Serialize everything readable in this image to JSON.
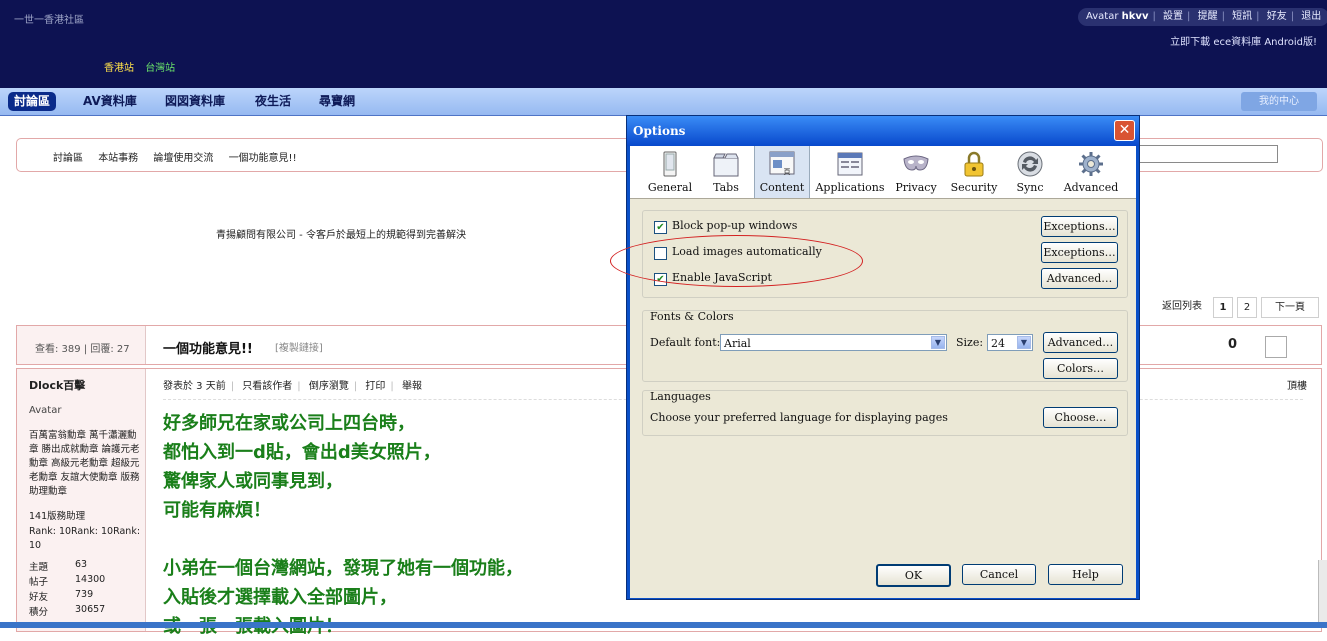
{
  "forum": {
    "site_name": "一世一香港社區",
    "stations": [
      "香港站",
      "台灣站"
    ],
    "userbar": {
      "avatar_label": "Avatar",
      "username": "hkvv",
      "links": [
        "設置",
        "提醒",
        "短訊",
        "好友",
        "退出"
      ]
    },
    "download_note": "立即下載 ece資料庫 Android版!",
    "nav": {
      "tabs": [
        "討論區",
        "AV資料庫",
        "図図資料庫",
        "夜生活",
        "尋寶網"
      ],
      "my_center": "我的中心"
    },
    "breadcrumb": [
      "討論區",
      "本站事務",
      "論壇使用交流",
      "一個功能意見!!"
    ],
    "ad_text": "青揚顧問有限公司 - 令客戶於最短上的規範得到完善解決",
    "pager": {
      "back_label": "返回列表",
      "pages": [
        "1",
        "2"
      ],
      "next_label": "下一頁"
    },
    "thread": {
      "stats": "查看: 389 | 回覆: 27",
      "title": "一個功能意見!!",
      "copy_link": "[複製鏈接]",
      "reply_count": "0"
    },
    "post": {
      "author": "Dlock百擊",
      "avatar": "Avatar",
      "badges": "百萬富翁勳章 萬千瀟灑勳章 勝出成就勳章 論護元老勳章 高級元老勳章 超級元老勳章 友誼大使勳章 版務助理勳章",
      "points": "141版務助理",
      "rank": "Rank: 10Rank: 10Rank: 10",
      "stats": [
        {
          "label": "主題",
          "value": "63"
        },
        {
          "label": "帖子",
          "value": "14300"
        },
        {
          "label": "好友",
          "value": "739"
        },
        {
          "label": "積分",
          "value": "30657"
        }
      ],
      "toolbar": [
        "發表於 3 天前",
        "只看該作者",
        "倒序瀏覽",
        "打印",
        "舉報"
      ],
      "top_link": "頂樓",
      "body_lines": [
        "好多師兄在家或公司上四台時，",
        "都怕入到一d貼，會出d美女照片，",
        "驚俾家人或同事見到，",
        "可能有麻煩！",
        "",
        "小弟在一個台灣網站，發現了她有一個功能，",
        "入貼後才選擇載入全部圖片，",
        "或一張一張載入圖片！"
      ]
    }
  },
  "dialog": {
    "title": "Options",
    "close_glyph": "✕",
    "panes": [
      {
        "label": "General",
        "icon": "general-icon"
      },
      {
        "label": "Tabs",
        "icon": "tabs-icon"
      },
      {
        "label": "Content",
        "icon": "content-icon",
        "selected": true
      },
      {
        "label": "Applications",
        "icon": "applications-icon"
      },
      {
        "label": "Privacy",
        "icon": "privacy-icon"
      },
      {
        "label": "Security",
        "icon": "security-icon"
      },
      {
        "label": "Sync",
        "icon": "sync-icon"
      },
      {
        "label": "Advanced",
        "icon": "advanced-icon"
      }
    ],
    "content_group": {
      "block_popups": {
        "label": "Block pop-up windows",
        "checked": true,
        "button": "Exceptions…"
      },
      "load_images": {
        "label": "Load images automatically",
        "checked": false,
        "button": "Exceptions…"
      },
      "enable_js": {
        "label": "Enable JavaScript",
        "checked": true,
        "button": "Advanced…"
      }
    },
    "fonts_group": {
      "title": "Fonts & Colors",
      "default_font_label": "Default font:",
      "default_font_value": "Arial",
      "size_label": "Size:",
      "size_value": "24",
      "advanced_button": "Advanced…",
      "colors_button": "Colors…"
    },
    "languages_group": {
      "title": "Languages",
      "description": "Choose your preferred language for displaying pages",
      "choose_button": "Choose…"
    },
    "footer": {
      "ok": "OK",
      "cancel": "Cancel",
      "help": "Help"
    }
  },
  "colors": {
    "header_bg": "#0d1252",
    "post_text": "#1a7f1a",
    "dialog_frame": "#0a50c8",
    "annotation": "#d32222"
  }
}
